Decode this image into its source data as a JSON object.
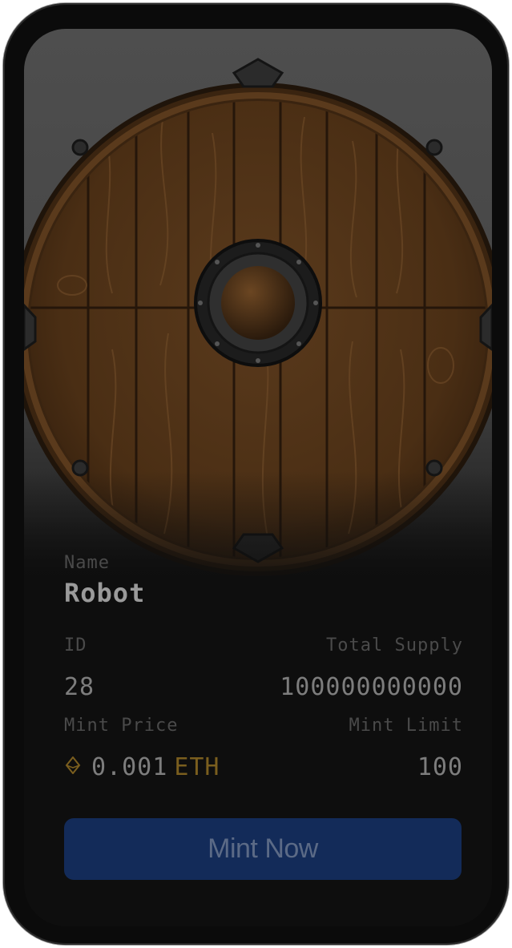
{
  "card": {
    "image_alt": "wooden round shield",
    "name_label": "Name",
    "name_value": "Robot",
    "id_label": "ID",
    "id_value": "28",
    "total_supply_label": "Total Supply",
    "total_supply_value": "100000000000",
    "mint_price_label": "Mint Price",
    "mint_price_value": "0.001",
    "mint_price_unit": "ETH",
    "mint_price_icon": "ethereum-icon",
    "mint_limit_label": "Mint Limit",
    "mint_limit_value": "100",
    "mint_button_label": "Mint Now"
  },
  "colors": {
    "button_bg": "#132b59",
    "eth_accent": "#7a5e1e",
    "background": "#0e0e0e"
  }
}
